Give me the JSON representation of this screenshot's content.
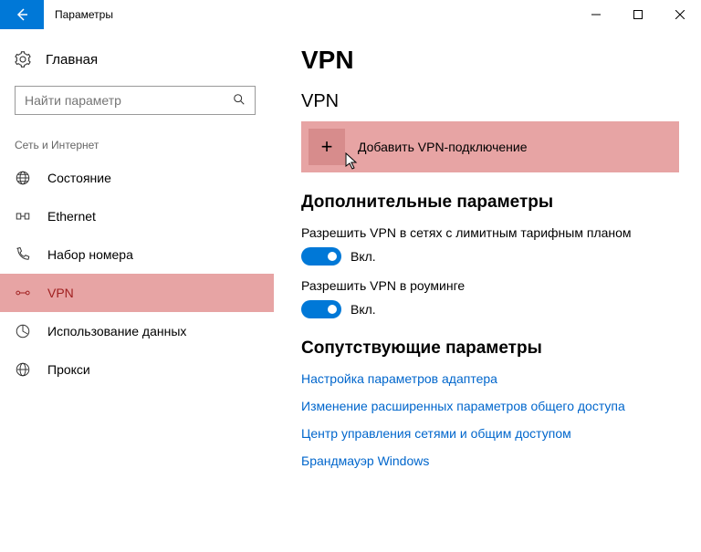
{
  "window": {
    "title": "Параметры"
  },
  "sidebar": {
    "home": "Главная",
    "search_placeholder": "Найти параметр",
    "group": "Сеть и Интернет",
    "items": [
      {
        "label": "Состояние"
      },
      {
        "label": "Ethernet"
      },
      {
        "label": "Набор номера"
      },
      {
        "label": "VPN"
      },
      {
        "label": "Использование данных"
      },
      {
        "label": "Прокси"
      }
    ]
  },
  "main": {
    "page_title": "VPN",
    "vpn_section": "VPN",
    "add_vpn": "Добавить VPN-подключение",
    "advanced_title": "Дополнительные параметры",
    "setting1_label": "Разрешить VPN в сетях с лимитным тарифным планом",
    "setting1_state": "Вкл.",
    "setting2_label": "Разрешить VPN в роуминге",
    "setting2_state": "Вкл.",
    "related_title": "Сопутствующие параметры",
    "links": [
      "Настройка параметров адаптера",
      "Изменение расширенных параметров общего доступа",
      "Центр управления сетями и общим доступом",
      "Брандмауэр Windows"
    ]
  }
}
